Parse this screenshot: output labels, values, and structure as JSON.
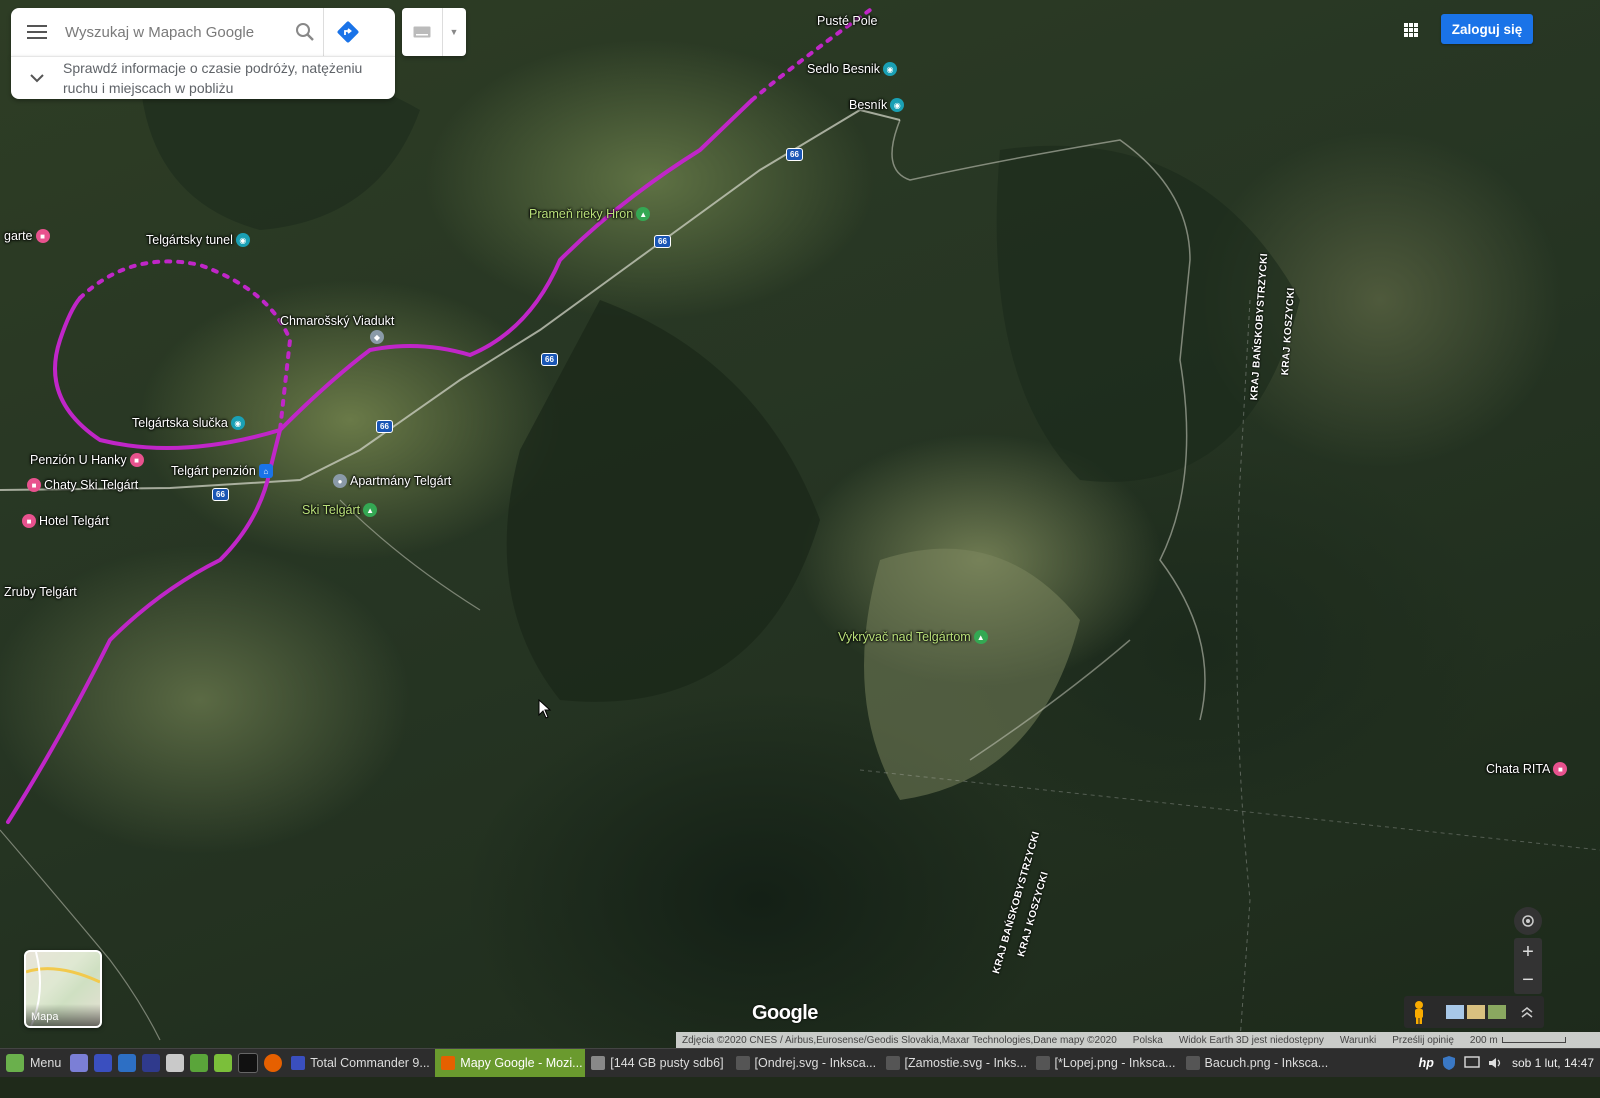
{
  "search": {
    "placeholder": "Wyszukaj w Mapach Google",
    "travel_info": "Sprawdź informacje o czasie podróży, natężeniu ruchu i miejscach w pobliżu"
  },
  "header": {
    "signin_label": "Zaloguj się"
  },
  "places": [
    {
      "name": "Pusté Pole",
      "kind": "none"
    },
    {
      "name": "Sedlo Besnik",
      "kind": "teal"
    },
    {
      "name": "Besník",
      "kind": "teal"
    },
    {
      "name": "Prameň rieky Hron",
      "kind": "green"
    },
    {
      "name": "garte",
      "kind": "hotel"
    },
    {
      "name": "Telgártsky tunel",
      "kind": "teal"
    },
    {
      "name": "Chmarošský Viadukt",
      "kind": "gray"
    },
    {
      "name": "Telgártska slučka",
      "kind": "teal"
    },
    {
      "name": "Penzión U Hanky",
      "kind": "hotel"
    },
    {
      "name": "Telgárt penzión",
      "kind": "blue"
    },
    {
      "name": "Chaty Ski Telgárt",
      "kind": "hotel"
    },
    {
      "name": "Apartmány Telgárt",
      "kind": "gray"
    },
    {
      "name": "Ski Telgárt",
      "kind": "green"
    },
    {
      "name": "Hotel Telgárt",
      "kind": "hotel"
    },
    {
      "name": "Zruby Telgárt",
      "kind": "hotel"
    },
    {
      "name": "Vykrývač nad Telgártom",
      "kind": "green"
    },
    {
      "name": "Chata RITA",
      "kind": "hotel"
    }
  ],
  "route_signs": [
    "66",
    "66",
    "66",
    "66",
    "66"
  ],
  "boundaries": [
    "KRAJ BAŃSKOBYSTRZYCKI",
    "KRAJ KOSZYCKI",
    "KRAJ BAŃSKOBYSTRZYCKI",
    "KRAJ KOSZYCKI"
  ],
  "layer_tile": {
    "label": "Mapa"
  },
  "logo": "Google",
  "footer": {
    "attribution": "Zdjęcia ©2020 CNES / Airbus,Eurosense/Geodis Slovakia,Maxar Technologies,Dane mapy ©2020",
    "country": "Polska",
    "earth": "Widok Earth 3D jest niedostępny",
    "terms": "Warunki",
    "feedback": "Prześlij opinię",
    "scale": "200 m"
  },
  "taskbar": {
    "menu_label": "Menu",
    "tasks": [
      {
        "label": "Total Commander 9...",
        "active": false,
        "color": "#3a4fbf"
      },
      {
        "label": "Mapy Google - Mozi...",
        "active": true,
        "color": "#e66000"
      },
      {
        "label": "[144 GB pusty sdb6]",
        "active": false,
        "color": "#888888"
      },
      {
        "label": "[Ondrej.svg - Inksca...",
        "active": false,
        "color": "#555555"
      },
      {
        "label": "[Zamostie.svg - Inks...",
        "active": false,
        "color": "#555555"
      },
      {
        "label": "[*Lopej.png - Inksca...",
        "active": false,
        "color": "#555555"
      },
      {
        "label": "Bacuch.png - Inksca...",
        "active": false,
        "color": "#555555"
      }
    ],
    "clock": "sob 1 lut, 14:47"
  },
  "colors": {
    "route": "#c026c8",
    "accent": "#1a73e8",
    "active_task": "#6a9a2e"
  }
}
